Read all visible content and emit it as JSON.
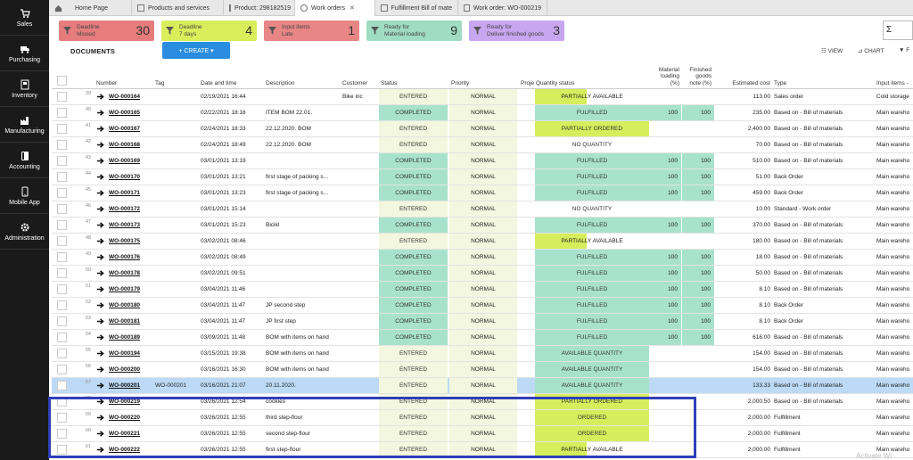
{
  "sidebar": [
    {
      "label": "Sales",
      "icon": "cart-icon"
    },
    {
      "label": "Purchasing",
      "icon": "truck-icon"
    },
    {
      "label": "Inventory",
      "icon": "inventory-icon"
    },
    {
      "label": "Manufacturing",
      "icon": "factory-icon"
    },
    {
      "label": "Accounting",
      "icon": "book-icon"
    },
    {
      "label": "Mobile App",
      "icon": "phone-icon"
    },
    {
      "label": "Administration",
      "icon": "gear-icon"
    }
  ],
  "tabs": [
    {
      "label": "Home Page"
    },
    {
      "label": "Products and services"
    },
    {
      "label": "Product: 298182519"
    },
    {
      "label": "Work orders"
    },
    {
      "label": "Fulfillment Bill of mate"
    },
    {
      "label": "Work order: WO-000219"
    }
  ],
  "cards": [
    {
      "line1": "Deadline",
      "line2": "Missed",
      "count": "30"
    },
    {
      "line1": "Deadline",
      "line2": "7 days",
      "count": "4"
    },
    {
      "line1": "Input items",
      "line2": "Late",
      "count": "1"
    },
    {
      "line1": "Ready for",
      "line2": "Material loading",
      "count": "9"
    },
    {
      "line1": "Ready for",
      "line2": "Deliver finished goods",
      "count": "3"
    }
  ],
  "search_symbol": "Σ",
  "toolbar": {
    "title": "DOCUMENTS",
    "create": "+   CREATE  ▾",
    "view": "VIEW",
    "chart": "CHART",
    "filter": "F"
  },
  "headers": {
    "number": "Number",
    "tag": "Tag",
    "date": "Date and time",
    "description": "Description",
    "customer": "Customer",
    "status": "Status",
    "priority": "Priority",
    "project": "Proje",
    "quantity_status": "Quantity status",
    "material_loading": "Material loading (%)",
    "finished_goods": "Finished goods note (%)",
    "estimated_cost": "Estimated cost",
    "type": "Type",
    "input_items": "Input items -"
  },
  "rows": [
    {
      "n": "39",
      "num": "WO-000164",
      "tag": "",
      "date": "02/19/2021 16:44",
      "desc": "",
      "cust": "Bike inc",
      "status": "ENTERED",
      "prio": "NORMAL",
      "qs": "PARTIALLY AVAILABLE",
      "ml": "",
      "fg": "",
      "cost": "113.00",
      "type": "Sales order",
      "input": "Cold storage"
    },
    {
      "n": "40",
      "num": "WO-000165",
      "tag": "",
      "date": "02/22/2021 18:16",
      "desc": "ITEM BOM 22.01.",
      "cust": "",
      "status": "COMPLETED",
      "prio": "NORMAL",
      "qs": "FULFILLED",
      "ml": "100",
      "fg": "100",
      "cost": "235.00",
      "type": "Based on - Bill of materials",
      "input": "Main wareho"
    },
    {
      "n": "41",
      "num": "WO-000167",
      "tag": "",
      "date": "02/24/2021 18:33",
      "desc": "22.12.2020. BOM",
      "cust": "",
      "status": "ENTERED",
      "prio": "NORMAL",
      "qs": "PARTIALLY ORDERED",
      "ml": "",
      "fg": "",
      "cost": "2,400.00",
      "type": "Based on - Bill of materials",
      "input": "Main wareho"
    },
    {
      "n": "42",
      "num": "WO-000168",
      "tag": "",
      "date": "02/24/2021 18:49",
      "desc": "22.12.2020. BOM",
      "cust": "",
      "status": "ENTERED",
      "prio": "NORMAL",
      "qs": "NO QUANTITY",
      "ml": "",
      "fg": "",
      "cost": "70.00",
      "type": "Based on - Bill of materials",
      "input": "Main wareho"
    },
    {
      "n": "43",
      "num": "WO-000169",
      "tag": "",
      "date": "03/01/2021 13:19",
      "desc": "",
      "cust": "",
      "status": "COMPLETED",
      "prio": "NORMAL",
      "qs": "FULFILLED",
      "ml": "100",
      "fg": "100",
      "cost": "510.00",
      "type": "Based on - Bill of materials",
      "input": "Main wareho"
    },
    {
      "n": "44",
      "num": "WO-000170",
      "tag": "",
      "date": "03/01/2021 13:21",
      "desc": "first stage of packing s...",
      "cust": "",
      "status": "COMPLETED",
      "prio": "NORMAL",
      "qs": "FULFILLED",
      "ml": "100",
      "fg": "100",
      "cost": "51.00",
      "type": "Back Order",
      "input": "Main wareho"
    },
    {
      "n": "45",
      "num": "WO-000171",
      "tag": "",
      "date": "03/01/2021 13:23",
      "desc": "first stage of packing s...",
      "cust": "",
      "status": "COMPLETED",
      "prio": "NORMAL",
      "qs": "FULFILLED",
      "ml": "100",
      "fg": "100",
      "cost": "459.00",
      "type": "Back Order",
      "input": "Main wareho"
    },
    {
      "n": "46",
      "num": "WO-000172",
      "tag": "",
      "date": "03/01/2021 15:14",
      "desc": "",
      "cust": "",
      "status": "ENTERED",
      "prio": "NORMAL",
      "qs": "NO QUANTITY",
      "ml": "",
      "fg": "",
      "cost": "10.00",
      "type": "Standard - Work order",
      "input": "Main wareho"
    },
    {
      "n": "47",
      "num": "WO-000173",
      "tag": "",
      "date": "03/01/2021 15:23",
      "desc": "Bicikl",
      "cust": "",
      "status": "COMPLETED",
      "prio": "NORMAL",
      "qs": "FULFILLED",
      "ml": "100",
      "fg": "100",
      "cost": "370.00",
      "type": "Based on - Bill of materials",
      "input": "Main wareho"
    },
    {
      "n": "48",
      "num": "WO-000175",
      "tag": "",
      "date": "03/02/2021 08:46",
      "desc": "",
      "cust": "",
      "status": "ENTERED",
      "prio": "NORMAL",
      "qs": "PARTIALLY AVAILABLE",
      "ml": "",
      "fg": "",
      "cost": "180.00",
      "type": "Based on - Bill of materials",
      "input": "Main wareho"
    },
    {
      "n": "49",
      "num": "WO-000176",
      "tag": "",
      "date": "03/02/2021 08:49",
      "desc": "",
      "cust": "",
      "status": "COMPLETED",
      "prio": "NORMAL",
      "qs": "FULFILLED",
      "ml": "100",
      "fg": "100",
      "cost": "18.00",
      "type": "Based on - Bill of materials",
      "input": "Main wareho"
    },
    {
      "n": "50",
      "num": "WO-000178",
      "tag": "",
      "date": "03/02/2021 09:51",
      "desc": "",
      "cust": "",
      "status": "COMPLETED",
      "prio": "NORMAL",
      "qs": "FULFILLED",
      "ml": "100",
      "fg": "100",
      "cost": "50.00",
      "type": "Based on - Bill of materials",
      "input": "Main wareho"
    },
    {
      "n": "51",
      "num": "WO-000179",
      "tag": "",
      "date": "03/04/2021 11:46",
      "desc": "",
      "cust": "",
      "status": "COMPLETED",
      "prio": "NORMAL",
      "qs": "FULFILLED",
      "ml": "100",
      "fg": "100",
      "cost": "8.10",
      "type": "Based on - Bill of materials",
      "input": "Main wareho"
    },
    {
      "n": "52",
      "num": "WO-000180",
      "tag": "",
      "date": "03/04/2021 11:47",
      "desc": "JP second step",
      "cust": "",
      "status": "COMPLETED",
      "prio": "NORMAL",
      "qs": "FULFILLED",
      "ml": "100",
      "fg": "100",
      "cost": "8.10",
      "type": "Back Order",
      "input": "Main wareho"
    },
    {
      "n": "53",
      "num": "WO-000181",
      "tag": "",
      "date": "03/04/2021 11:47",
      "desc": "JP first step",
      "cust": "",
      "status": "COMPLETED",
      "prio": "NORMAL",
      "qs": "FULFILLED",
      "ml": "100",
      "fg": "100",
      "cost": "8.10",
      "type": "Back Order",
      "input": "Main wareho"
    },
    {
      "n": "54",
      "num": "WO-000189",
      "tag": "",
      "date": "03/09/2021 11:48",
      "desc": "BOM with items on hand",
      "cust": "",
      "status": "COMPLETED",
      "prio": "NORMAL",
      "qs": "FULFILLED",
      "ml": "100",
      "fg": "100",
      "cost": "616.00",
      "type": "Based on - Bill of materials",
      "input": "Main wareho"
    },
    {
      "n": "55",
      "num": "WO-000194",
      "tag": "",
      "date": "03/15/2021 19:38",
      "desc": "BOM with items on hand",
      "cust": "",
      "status": "ENTERED",
      "prio": "NORMAL",
      "qs": "AVAILABLE QUANTITY",
      "ml": "",
      "fg": "",
      "cost": "154.00",
      "type": "Based on - Bill of materials",
      "input": "Main wareho"
    },
    {
      "n": "56",
      "num": "WO-000200",
      "tag": "",
      "date": "03/16/2021 16:30",
      "desc": "BOM with items on hand",
      "cust": "",
      "status": "ENTERED",
      "prio": "NORMAL",
      "qs": "AVAILABLE QUANTITY",
      "ml": "",
      "fg": "",
      "cost": "154.00",
      "type": "Based on - Bill of materials",
      "input": "Main wareho"
    },
    {
      "n": "57",
      "num": "WO-000201",
      "tag": "WO-000201",
      "date": "03/16/2021 21:07",
      "desc": "20.11.2020.",
      "cust": "",
      "status": "ENTERED",
      "prio": "NORMAL",
      "qs": "AVAILABLE QUANTITY",
      "ml": "",
      "fg": "",
      "cost": "133.33",
      "type": "Based on - Bill of materials",
      "input": "Main wareho"
    },
    {
      "n": "58",
      "num": "WO-000219",
      "tag": "",
      "date": "03/26/2021 12:54",
      "desc": "cookies",
      "cust": "",
      "status": "ENTERED",
      "prio": "NORMAL",
      "qs": "PARTIALLY ORDERED",
      "ml": "",
      "fg": "",
      "cost": "2,000.50",
      "type": "Based on - Bill of materials",
      "input": "Main wareho"
    },
    {
      "n": "59",
      "num": "WO-000220",
      "tag": "",
      "date": "03/26/2021 12:55",
      "desc": "third step-flour",
      "cust": "",
      "status": "ENTERED",
      "prio": "NORMAL",
      "qs": "ORDERED",
      "ml": "",
      "fg": "",
      "cost": "2,000.00",
      "type": "Fulfillment",
      "input": "Main wareho"
    },
    {
      "n": "60",
      "num": "WO-000221",
      "tag": "",
      "date": "03/26/2021 12:55",
      "desc": "second step-flour",
      "cust": "",
      "status": "ENTERED",
      "prio": "NORMAL",
      "qs": "ORDERED",
      "ml": "",
      "fg": "",
      "cost": "2,000.00",
      "type": "Fulfillment",
      "input": "Main wareho"
    },
    {
      "n": "61",
      "num": "WO-000222",
      "tag": "",
      "date": "03/26/2021 12:55",
      "desc": "first step-flour",
      "cust": "",
      "status": "ENTERED",
      "prio": "NORMAL",
      "qs": "PARTIALLY AVAILABLE",
      "ml": "",
      "fg": "",
      "cost": "2,000.00",
      "type": "Fulfillment",
      "input": "Main wareho"
    }
  ],
  "watermark": "Activate Wi",
  "colors": {
    "accent": "#2a8de0",
    "sidebar": "#1a1a1a",
    "green": "#a8e2cc",
    "yellow": "#d7ee5c",
    "selected": "#bcdaf5",
    "highlight": "#2f3fb8"
  }
}
